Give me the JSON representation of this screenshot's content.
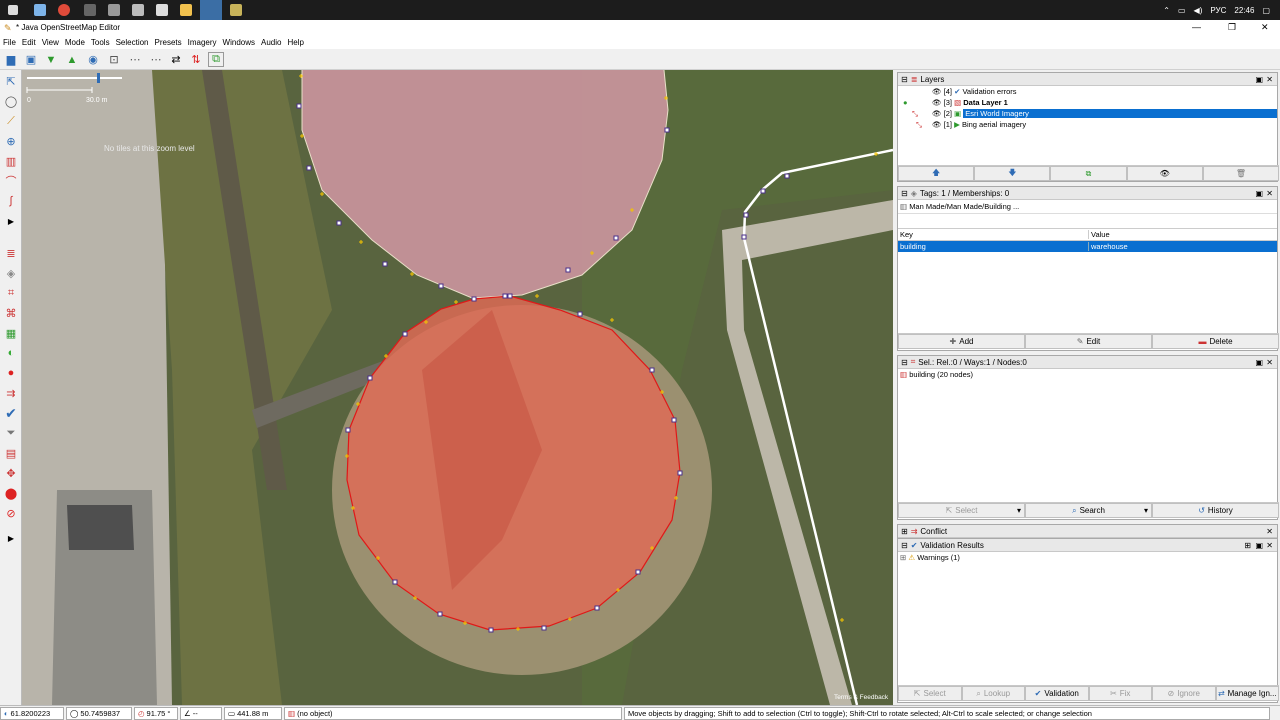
{
  "taskbar": {
    "lang": "РУС",
    "time": "22:46"
  },
  "window": {
    "title": "* Java OpenStreetMap Editor",
    "minimize": "—",
    "maximize": "❐",
    "close": "✕"
  },
  "menu": [
    "File",
    "Edit",
    "View",
    "Mode",
    "Tools",
    "Selection",
    "Presets",
    "Imagery",
    "Windows",
    "Audio",
    "Help"
  ],
  "map": {
    "scale_start": "0",
    "scale_end": "30.0 m",
    "no_tiles": "No tiles at this zoom level",
    "attribution": "Terms & Feedback"
  },
  "layers": {
    "title": "Layers",
    "items": [
      {
        "num": "[4]",
        "name": "Validation errors",
        "active": false,
        "bold": false
      },
      {
        "num": "[3]",
        "name": "Data Layer 1",
        "active": false,
        "bold": true
      },
      {
        "num": "[2]",
        "name": "Esri World Imagery",
        "active": true,
        "bold": false
      },
      {
        "num": "[1]",
        "name": "Bing aerial imagery",
        "active": false,
        "bold": false
      }
    ]
  },
  "tags": {
    "title": "Tags: 1 / Memberships: 0",
    "preset": "Man Made/Man Made/Building ...",
    "col_key": "Key",
    "col_value": "Value",
    "rows": [
      {
        "key": "building",
        "value": "warehouse"
      }
    ],
    "add": "Add",
    "edit": "Edit",
    "delete": "Delete"
  },
  "selection": {
    "title": "Sel.: Rel.:0 / Ways:1 / Nodes:0",
    "item": "building (20 nodes)",
    "select": "Select",
    "search": "Search",
    "history": "History"
  },
  "conflict": {
    "title": "Conflict"
  },
  "validation": {
    "title": "Validation Results",
    "warnings": "Warnings (1)",
    "buttons": [
      "Select",
      "Lookup",
      "Validation",
      "Fix",
      "Ignore",
      "Manage Ign..."
    ]
  },
  "status": {
    "lat": "61.8200223",
    "lon": "50.7459837",
    "heading": "91.75 °",
    "angle": "--",
    "distance": "441.88 m",
    "object": "(no object)",
    "help": "Move objects by dragging; Shift to add to selection (Ctrl to toggle); Shift-Ctrl to rotate selected; Alt-Ctrl to scale selected; or change selection"
  }
}
